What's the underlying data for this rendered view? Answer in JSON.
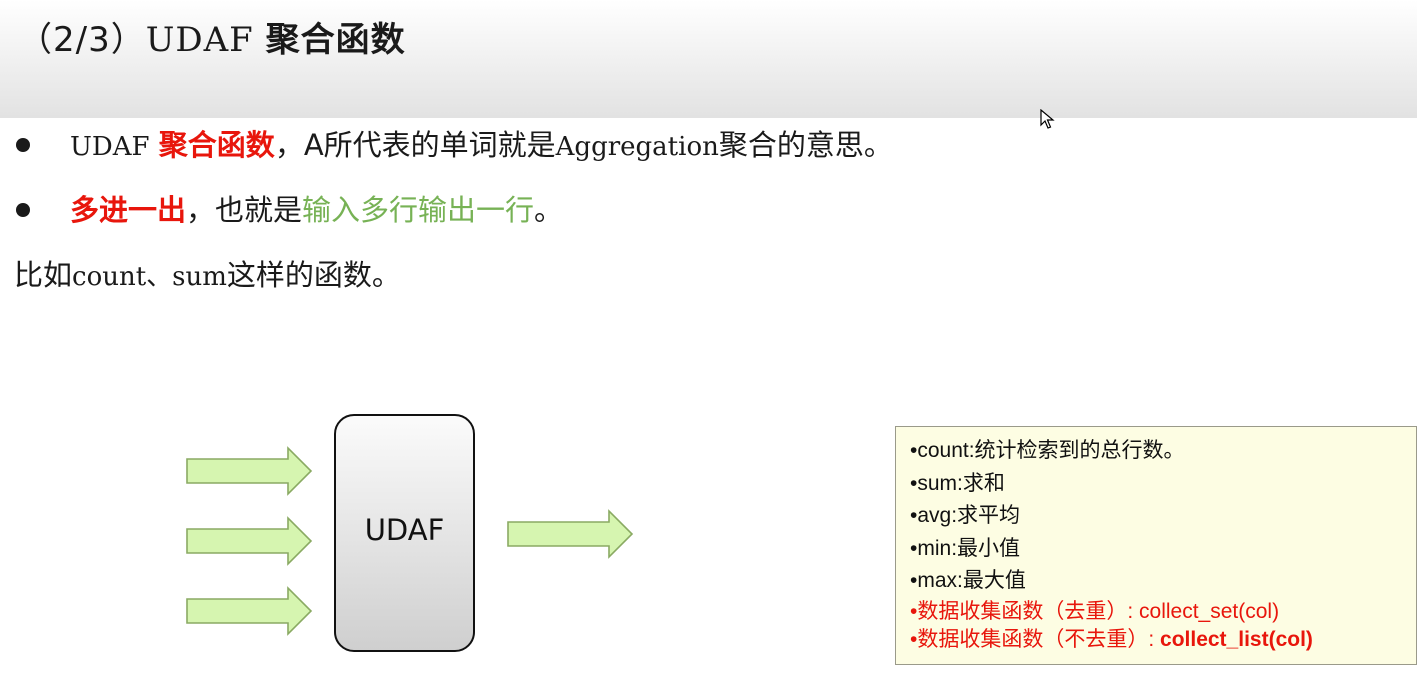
{
  "header": {
    "prefix": "（2/3）",
    "code": "UDAF",
    "name": "聚合函数"
  },
  "bullets": [
    {
      "code": "UDAF",
      "highlight": "聚合函数",
      "text1": "，A所代表的单词就是",
      "word": "Aggregation",
      "text2": "聚合的意思。"
    },
    {
      "highlight": "多进一出",
      "text1": "，也就是",
      "green": "输入多行输出一行",
      "text2": "。"
    }
  ],
  "example": {
    "text1": "比如",
    "code": "count、sum",
    "text2": "这样的函数。"
  },
  "diagram": {
    "box_label": "UDAF",
    "input_count": 3,
    "output_count": 1,
    "arrow_color": "#d6f5b0",
    "arrow_stroke": "#8aaa63"
  },
  "functions": {
    "items": [
      "•count:统计检索到的总行数。",
      "•sum:求和",
      "•avg:求平均",
      "•min:最小值",
      "•max:最大值"
    ],
    "red_items": [
      "•数据收集函数（去重）: collect_set(col)"
    ],
    "last": {
      "prefix": "•数据收集函数（不去重）:",
      "bold": " collect_list(col)"
    },
    "accent": "#e8160c",
    "background": "#fdfde3"
  }
}
